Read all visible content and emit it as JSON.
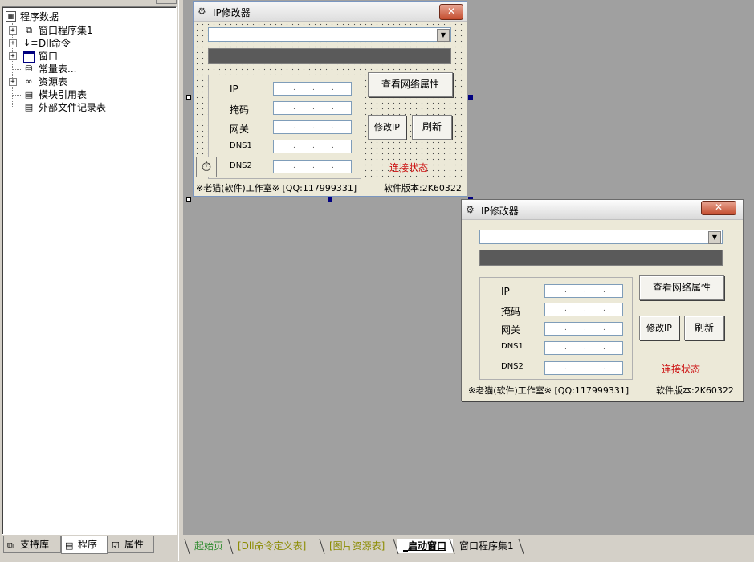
{
  "tree": {
    "root": "程序数据",
    "items": [
      {
        "label": "窗口程序集1",
        "icon": "layers-icon",
        "glyph": "⧉",
        "expandable": true
      },
      {
        "label": "Dll命令",
        "icon": "dll-command-icon",
        "glyph": "↓",
        "expandable": true
      },
      {
        "label": "窗口",
        "icon": "window-icon",
        "glyph": "▭",
        "expandable": true
      },
      {
        "label": "常量表...",
        "icon": "constant-table-icon",
        "glyph": "⛁",
        "expandable": false
      },
      {
        "label": "资源表",
        "icon": "resource-icon",
        "glyph": "∞",
        "expandable": true
      },
      {
        "label": "模块引用表",
        "icon": "module-ref-icon",
        "glyph": "▤",
        "expandable": false
      },
      {
        "label": "外部文件记录表",
        "icon": "external-file-icon",
        "glyph": "▤",
        "expandable": false
      }
    ]
  },
  "left_tabs": [
    {
      "label": "支持库",
      "icon": "library-icon"
    },
    {
      "label": "程序",
      "icon": "program-icon"
    },
    {
      "label": "属性",
      "icon": "properties-icon"
    }
  ],
  "doc_tabs": [
    {
      "label": "起始页",
      "color": "#2e8b2e"
    },
    {
      "label": "[Dll命令定义表]",
      "color": "#8b8b00"
    },
    {
      "label": "[图片资源表]",
      "color": "#8b8b00"
    },
    {
      "label": "_启动窗口",
      "color": "#000000"
    },
    {
      "label": "窗口程序集1",
      "color": "#000000"
    }
  ],
  "design_form": {
    "title": "IP修改器",
    "close_glyph": "✕",
    "fields": [
      {
        "label": "IP",
        "value": ". . ."
      },
      {
        "label": "掩码",
        "value": ". . ."
      },
      {
        "label": "网关",
        "value": ". . ."
      },
      {
        "label": "DNS1",
        "value": ". . ."
      },
      {
        "label": "DNS2",
        "value": ". . ."
      }
    ],
    "btn_view_network": "查看网络属性",
    "btn_modify_ip": "修改IP",
    "btn_refresh": "刷新",
    "status": "连接状态",
    "footer_left": "※老猫(软件)工作室※ [QQ:117999331]",
    "footer_right": "软件版本:2K60322",
    "timer_glyph": "⏱"
  },
  "preview_form": {
    "title": "IP修改器",
    "close_glyph": "✕",
    "fields": [
      {
        "label": "IP",
        "value": ". . ."
      },
      {
        "label": "掩码",
        "value": ". . ."
      },
      {
        "label": "网关",
        "value": ". . ."
      },
      {
        "label": "DNS1",
        "value": ". . ."
      },
      {
        "label": "DNS2",
        "value": ". . ."
      }
    ],
    "btn_view_network": "查看网络属性",
    "btn_modify_ip": "修改IP",
    "btn_refresh": "刷新",
    "status": "连接状态",
    "footer_left": "※老猫(软件)工作室※ [QQ:117999331]",
    "footer_right": "软件版本:2K60322"
  },
  "colors": {
    "designer_bg": "#a0a0a0",
    "status_red": "#cc1010",
    "progress": "#5a5a5a"
  }
}
